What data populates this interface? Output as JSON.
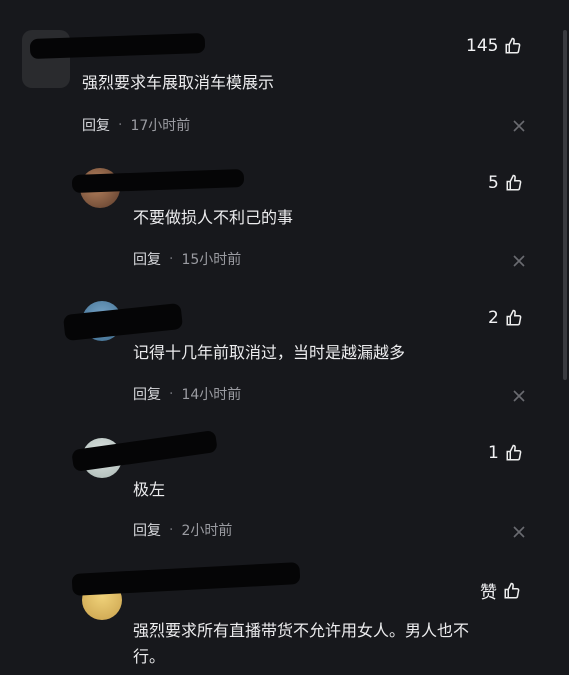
{
  "comments": [
    {
      "text": "强烈要求车展取消车模展示",
      "reply_label": "回复",
      "time": "17小时前",
      "likes": "145"
    },
    {
      "text": "不要做损人不利己的事",
      "reply_label": "回复",
      "time": "15小时前",
      "likes": "5"
    },
    {
      "text": "记得十几年前取消过，当时是越漏越多",
      "reply_label": "回复",
      "time": "14小时前",
      "likes": "2"
    },
    {
      "text": "极左",
      "reply_label": "回复",
      "time": "2小时前",
      "likes": "1"
    },
    {
      "text_line1": "强烈要求所有直播带货不允许用女人。男人也不",
      "text_line2": "行。",
      "likes": "赞"
    }
  ],
  "dot": "·",
  "icons": {
    "like": "thumbs-up-icon",
    "close": "close-icon"
  },
  "colors": {
    "background": "#17181c",
    "text": "#ececee",
    "muted": "#9a9ba1"
  }
}
